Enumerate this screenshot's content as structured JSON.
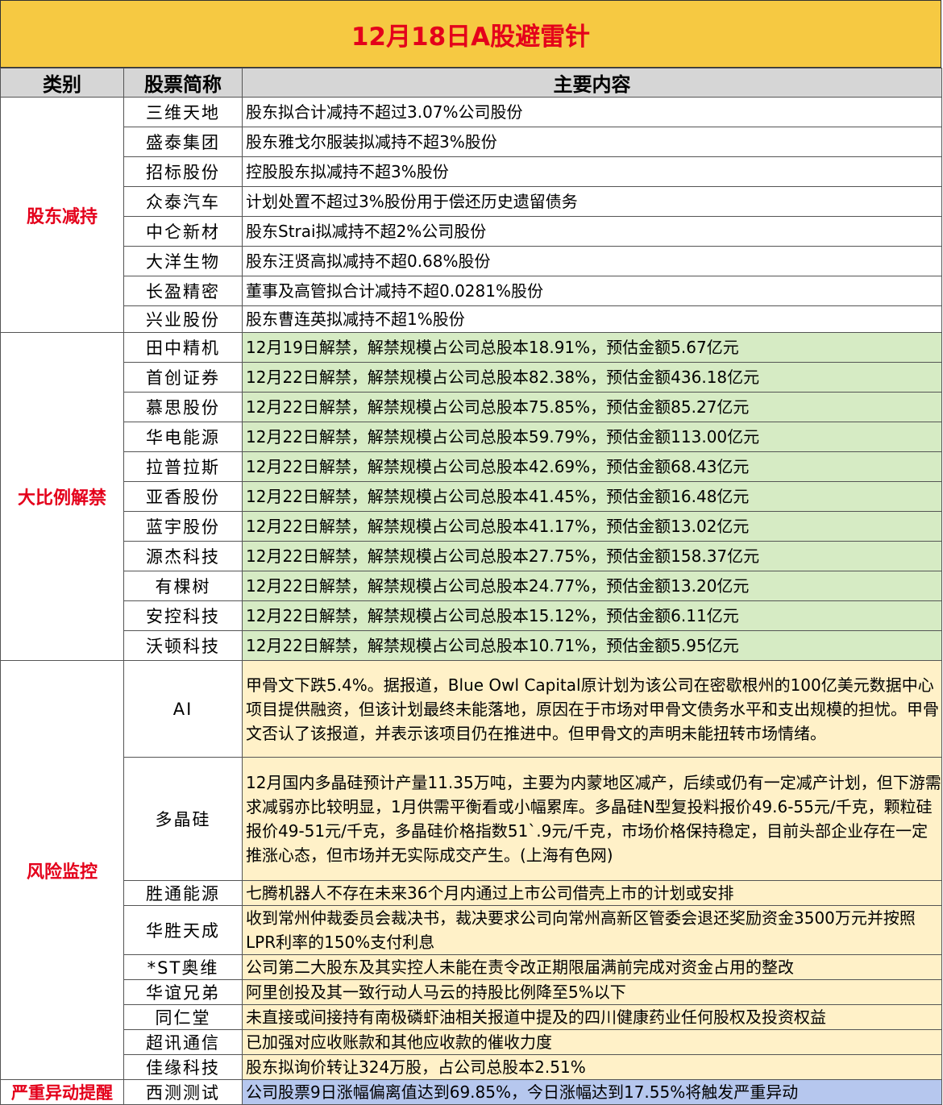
{
  "title": "12月18日A股避雷针",
  "headers": {
    "category": "类别",
    "name": "股票简称",
    "content": "主要内容"
  },
  "colors": {
    "title_bg": "#f6c942",
    "title_text": "#e4001b",
    "green": "#d6ebc4",
    "yellow": "#fff1c8",
    "blue": "#b6c7ee"
  },
  "groups": [
    {
      "category": "股东减持",
      "style": "white",
      "rows": [
        {
          "name": "三维天地",
          "content": "股东拟合计减持不超过3.07%公司股份"
        },
        {
          "name": "盛泰集团",
          "content": "股东雅戈尔服装拟减持不超3%股份"
        },
        {
          "name": "招标股份",
          "content": "控股股东拟减持不超3%股份"
        },
        {
          "name": "众泰汽车",
          "content": "计划处置不超过3%股份用于偿还历史遗留债务"
        },
        {
          "name": "中仑新材",
          "content": "股东Strai拟减持不超2%公司股份"
        },
        {
          "name": "大洋生物",
          "content": "股东汪贤高拟减持不超0.68%股份"
        },
        {
          "name": "长盈精密",
          "content": "董事及高管拟合计减持不超0.0281%股份"
        },
        {
          "name": "兴业股份",
          "content": "股东曹连英拟减持不超1%股份"
        }
      ]
    },
    {
      "category": "大比例解禁",
      "style": "green",
      "rows": [
        {
          "name": "田中精机",
          "content": "12月19日解禁，解禁规模占公司总股本18.91%，预估金额5.67亿元"
        },
        {
          "name": "首创证券",
          "content": "12月22日解禁，解禁规模占公司总股本82.38%，预估金额436.18亿元"
        },
        {
          "name": "慕思股份",
          "content": "12月22日解禁，解禁规模占公司总股本75.85%，预估金额85.27亿元"
        },
        {
          "name": "华电能源",
          "content": "12月22日解禁，解禁规模占公司总股本59.79%，预估金额113.00亿元"
        },
        {
          "name": "拉普拉斯",
          "content": "12月22日解禁，解禁规模占公司总股本42.69%，预估金额68.43亿元"
        },
        {
          "name": "亚香股份",
          "content": "12月22日解禁，解禁规模占公司总股本41.45%，预估金额16.48亿元"
        },
        {
          "name": "蓝宇股份",
          "content": "12月22日解禁，解禁规模占公司总股本41.17%，预估金额13.02亿元"
        },
        {
          "name": "源杰科技",
          "content": "12月22日解禁，解禁规模占公司总股本27.75%，预估金额158.37亿元"
        },
        {
          "name": "有棵树",
          "content": "12月22日解禁，解禁规模占公司总股本24.77%，预估金额13.20亿元"
        },
        {
          "name": "安控科技",
          "content": "12月22日解禁，解禁规模占公司总股本15.12%，预估金额6.11亿元"
        },
        {
          "name": "沃顿科技",
          "content": "12月22日解禁，解禁规模占公司总股本10.71%，预估金额5.95亿元"
        }
      ]
    },
    {
      "category": "风险监控",
      "style": "yellow",
      "rows": [
        {
          "name": "AI",
          "content": "甲骨文下跌5.4%。据报道，Blue Owl Capital原计划为该公司在密歇根州的100亿美元数据中心项目提供融资，但该计划最终未能落地，原因在于市场对甲骨文债务水平和支出规模的担忧。甲骨文否认了该报道，并表示该项目仍在推进中。但甲骨文的声明未能扭转市场情绪。"
        },
        {
          "name": "多晶硅",
          "content": "12月国内多晶硅预计产量11.35万吨，主要为内蒙地区减产，后续或仍有一定减产计划，但下游需求减弱亦比较明显，1月供需平衡看或小幅累库。多晶硅N型复投料报价49.6-55元/千克，颗粒硅报价49-51元/千克，多晶硅价格指数51`.9元/千克，市场价格保持稳定，目前头部企业存在一定推涨心态，但市场并无实际成交产生。(上海有色网)"
        },
        {
          "name": "胜通能源",
          "content": "七腾机器人不存在未来36个月内通过上市公司借壳上市的计划或安排"
        },
        {
          "name": "华胜天成",
          "content": "收到常州仲裁委员会裁决书，裁决要求公司向常州高新区管委会退还奖励资金3500万元并按照LPR利率的150%支付利息"
        },
        {
          "name": "*ST奥维",
          "content": "公司第二大股东及其实控人未能在责令改正期限届满前完成对资金占用的整改"
        },
        {
          "name": "华谊兄弟",
          "content": "阿里创投及其一致行动人马云的持股比例降至5%以下"
        },
        {
          "name": "同仁堂",
          "content": "未直接或间接持有南极磷虾油相关报道中提及的四川健康药业任何股权及投资权益"
        },
        {
          "name": "超讯通信",
          "content": "已加强对应收账款和其他应收款的催收力度"
        },
        {
          "name": "佳缘科技",
          "content": "股东拟询价转让324万股，占公司总股本2.51%"
        }
      ]
    },
    {
      "category": "严重异动提醒",
      "style": "blue",
      "rows": [
        {
          "name": "西测测试",
          "content": "公司股票9日涨幅偏离值达到69.85%，今日涨幅达到17.55%将触发严重异动"
        }
      ]
    }
  ]
}
